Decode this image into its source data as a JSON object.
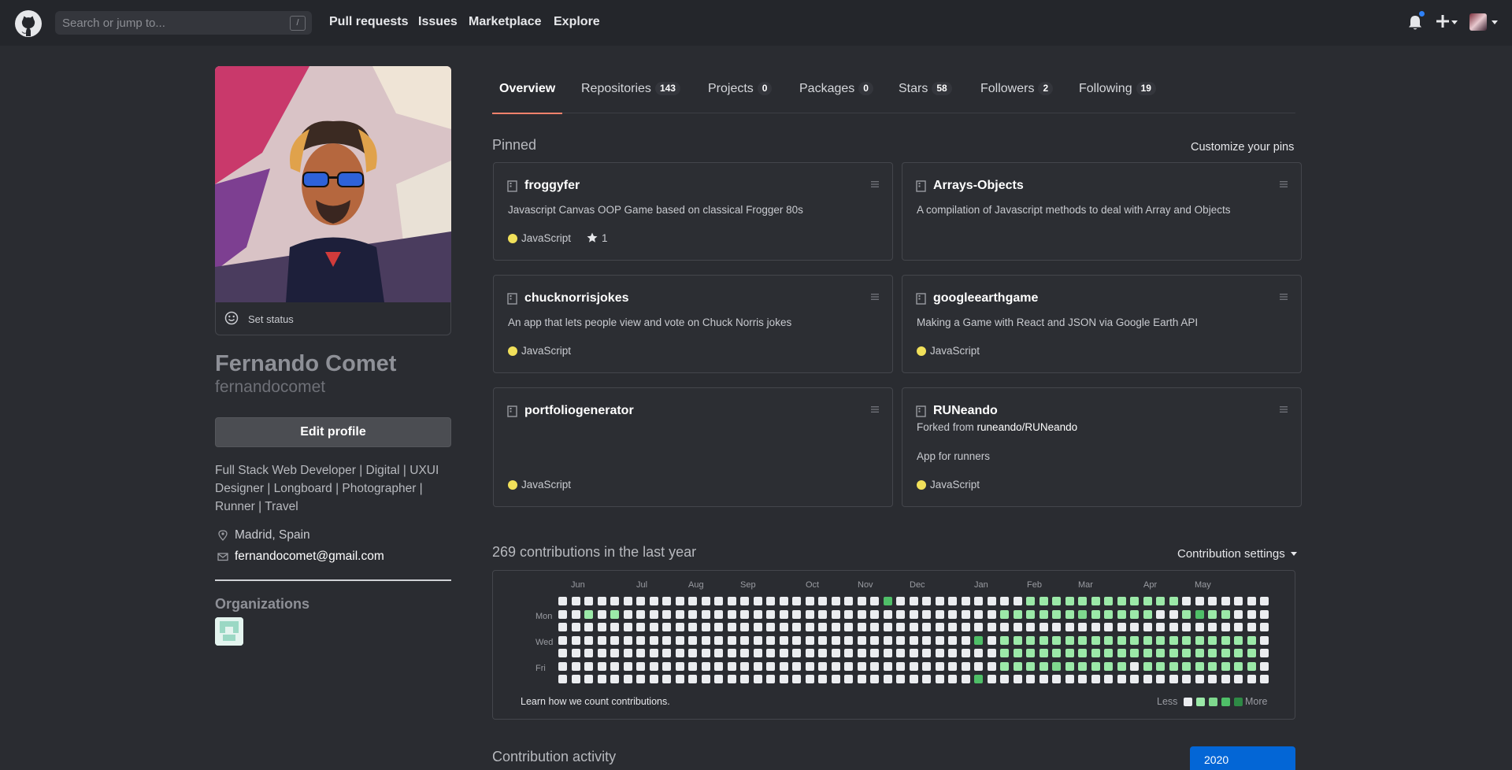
{
  "header": {
    "search_placeholder": "Search or jump to...",
    "search_shortcut": "/",
    "nav": [
      "Pull requests",
      "Issues",
      "Marketplace",
      "Explore"
    ]
  },
  "profile": {
    "set_status": "Set status",
    "fullname": "Fernando Comet",
    "username": "fernandocomet",
    "edit_profile": "Edit profile",
    "bio": "Full Stack Web Developer | Digital | UXUI Designer | Longboard | Photographer | Runner | Travel",
    "location": "Madrid, Spain",
    "email": "fernandocomet@gmail.com",
    "organizations_title": "Organizations"
  },
  "tabs": [
    {
      "label": "Overview",
      "count": null
    },
    {
      "label": "Repositories",
      "count": "143"
    },
    {
      "label": "Projects",
      "count": "0"
    },
    {
      "label": "Packages",
      "count": "0"
    },
    {
      "label": "Stars",
      "count": "58"
    },
    {
      "label": "Followers",
      "count": "2"
    },
    {
      "label": "Following",
      "count": "19"
    }
  ],
  "pinned": {
    "title": "Pinned",
    "customize": "Customize your pins",
    "repos": [
      {
        "name": "froggyfer",
        "description": "Javascript Canvas OOP Game based on classical Frogger 80s",
        "language": "JavaScript",
        "stars": "1"
      },
      {
        "name": "Arrays-Objects",
        "description": "A compilation of Javascript methods to deal with Array and Objects"
      },
      {
        "name": "chucknorrisjokes",
        "description": "An app that lets people view and vote on Chuck Norris jokes",
        "language": "JavaScript"
      },
      {
        "name": "googleearthgame",
        "description": "Making a Game with React and JSON via Google Earth API",
        "language": "JavaScript"
      },
      {
        "name": "portfoliogenerator",
        "language": "JavaScript"
      },
      {
        "name": "RUNeando",
        "forked_prefix": "Forked from",
        "forked_from": "runeando/RUNeando",
        "description": "App for runners",
        "language": "JavaScript"
      }
    ]
  },
  "contributions": {
    "title": "269 contributions in the last year",
    "settings": "Contribution settings",
    "months": [
      "Jun",
      "Jul",
      "Aug",
      "Sep",
      "Oct",
      "Nov",
      "Dec",
      "Jan",
      "Feb",
      "Mar",
      "Apr",
      "May"
    ],
    "days": [
      "Mon",
      "Wed",
      "Fri"
    ],
    "learn": "Learn how we count contributions.",
    "less": "Less",
    "more": "More",
    "level_colors": [
      "#ebedf0",
      "#9be9a8",
      "#7fd88e",
      "#4fbf68",
      "#2e8a45"
    ],
    "grid": [
      "0000000000000000000000000300000000001111111111110000000",
      "0010100000000000000000000000000000111111211111001311000",
      "0000000000000000000000000000000000000000000000000000000",
      "0000000000000000000000000000000030111111111111111111110",
      "0000000000000000000000000000000000111111111111111111110",
      "0000000000000000000000000000000000111121111101111111110",
      "0000000000000000000000000000000030000000000000000000000"
    ]
  },
  "activity": {
    "title": "Contribution activity",
    "year": "2020"
  }
}
